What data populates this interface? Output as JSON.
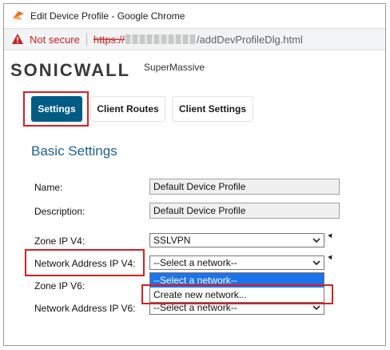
{
  "window": {
    "title": "Edit Device Profile - Google Chrome"
  },
  "address_bar": {
    "security_text": "Not secure",
    "url_scheme": "https://",
    "url_path": "/addDevProfileDlg.html"
  },
  "brand": {
    "logo_text_a": "SONIC",
    "logo_text_b": "WALL",
    "product": "SuperMassive"
  },
  "tabs": [
    {
      "label": "Settings",
      "active": true
    },
    {
      "label": "Client Routes",
      "active": false
    },
    {
      "label": "Client Settings",
      "active": false
    }
  ],
  "form": {
    "section_title": "Basic Settings",
    "name": {
      "label": "Name:",
      "value": "Default Device Profile"
    },
    "description": {
      "label": "Description:",
      "value": "Default Device Profile"
    },
    "zone_ipv4": {
      "label": "Zone IP V4:",
      "value": "SSLVPN"
    },
    "network_ipv4": {
      "label": "Network Address IP V4:",
      "value": "--Select a network--"
    },
    "zone_ipv6": {
      "label": "Zone IP V6:"
    },
    "network_ipv6": {
      "label": "Network Address IP V6:",
      "value": "--Select a network--"
    }
  },
  "dropdown": {
    "options": [
      "--Select a network--",
      "Create new network..."
    ],
    "highlighted": "--Select a network--"
  },
  "colors": {
    "accent": "#005c84",
    "highlight_box": "#d71f26",
    "selection": "#1e73e8"
  },
  "icons": [
    "chrome-app-icon",
    "warning-icon",
    "chevron-down-icon"
  ]
}
